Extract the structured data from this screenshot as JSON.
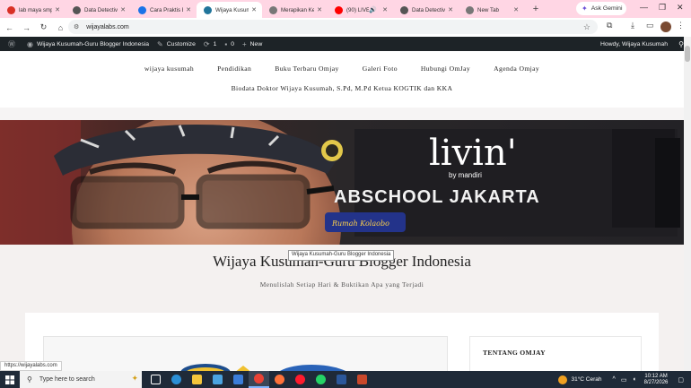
{
  "browser": {
    "tabs": [
      {
        "title": "lab maya smp",
        "favicon_color": "#d93025",
        "active": false
      },
      {
        "title": "Data Detective",
        "favicon_color": "#555555",
        "active": false
      },
      {
        "title": "Cara Praktis Bu",
        "favicon_color": "#1a73e8",
        "active": false
      },
      {
        "title": "Wijaya Kusumah",
        "favicon_color": "#21759b",
        "active": true
      },
      {
        "title": "Merapikan Kel",
        "favicon_color": "#777777",
        "active": false
      },
      {
        "title": "(90) LIVE",
        "favicon_color": "#ff0000",
        "active": false,
        "audio": true
      },
      {
        "title": "Data Detective",
        "favicon_color": "#555555",
        "active": false
      },
      {
        "title": "New Tab",
        "favicon_color": "#777777",
        "active": false
      }
    ],
    "gemini_label": "Ask Gemini",
    "url": "wijayalabs.com",
    "status_url": "https://wijayalabs.com"
  },
  "admin_bar": {
    "site_name": "Wijaya Kusumah-Guru Blogger Indonesia",
    "customize": "Customize",
    "updates_count": "1",
    "comments_count": "0",
    "new_label": "New",
    "howdy": "Howdy, Wijaya Kusumah"
  },
  "site_nav": {
    "row1": [
      "wijaya kusumah",
      "Pendidikan",
      "Buku Terbaru Omjay",
      "Galeri Foto",
      "Hubungi OmJay",
      "Agenda Omjay"
    ],
    "row2": [
      "Biodata Doktor Wijaya Kusumah, S.Pd, M.Pd Ketua KOGTIK dan KKA"
    ]
  },
  "banner": {
    "brand": "livin'",
    "brand_sub": "by mandiri",
    "wall_text": "ABSCHOOL JAKARTA",
    "sign_text": "Rumah Kolaobo"
  },
  "site": {
    "title": "Wijaya Kusumah-Guru Blogger Indonesia",
    "tagline": "Menulislah Setiap Hari & Buktikan Apa yang Terjadi",
    "tooltip": "Wijaya Kusumah-Guru Blogger Indonesia"
  },
  "sidebar": {
    "widget_title": "TENTANG OMJAY"
  },
  "taskbar": {
    "search_placeholder": "Type here to search",
    "apps": [
      {
        "name": "task-view",
        "color": "#ffffff"
      },
      {
        "name": "edge",
        "color": "#2b8fd6"
      },
      {
        "name": "file-explorer",
        "color": "#f3c53b"
      },
      {
        "name": "store",
        "color": "#4aa3df"
      },
      {
        "name": "mail",
        "color": "#3b7dd8"
      },
      {
        "name": "chrome",
        "color": "#e94235",
        "active": true
      },
      {
        "name": "firefox",
        "color": "#ff7139"
      },
      {
        "name": "opera",
        "color": "#ff1b2d"
      },
      {
        "name": "whatsapp",
        "color": "#25d366"
      },
      {
        "name": "word",
        "color": "#2b579a"
      },
      {
        "name": "app-grid",
        "color": "#c9482b"
      }
    ],
    "weather": "31°C  Cerah",
    "time": "10:12 AM",
    "date": "8/27/2026"
  }
}
